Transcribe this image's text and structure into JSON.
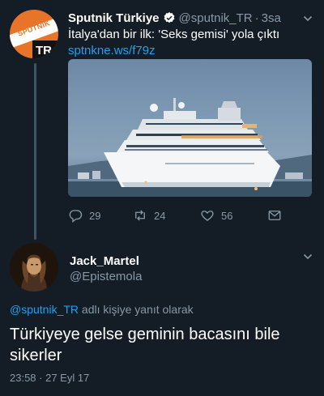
{
  "original_tweet": {
    "author_name": "Sputnik Türkiye",
    "author_handle": "@sputnik_TR",
    "separator": "·",
    "time_ago": "3sa",
    "text": "İtalya'dan bir ilk: 'Seks gemisi' yola çıktı",
    "link": "sptnkne.ws/f79z",
    "avatar_logo_text": "SPUTNIK",
    "avatar_badge": "TR",
    "brand_color": "#e8742a",
    "icons": {
      "verified": "verified-badge-icon",
      "menu": "chevron-down-icon"
    },
    "actions": {
      "reply_count": "29",
      "retweet_count": "24",
      "like_count": "56"
    }
  },
  "reply_tweet": {
    "author_name": "Jack_Martel",
    "author_handle": "@Epistemola",
    "reply_to_handle": "@sputnik_TR",
    "reply_to_suffix": " adlı kişiye yanıt olarak",
    "text": "Türkiyeye gelse geminin bacasını bile sikerler",
    "timestamp": "23:58 · 27 Eyl 17"
  },
  "colors": {
    "background": "#141d26",
    "link": "#1da1f2",
    "secondary_text": "#8899a6"
  }
}
